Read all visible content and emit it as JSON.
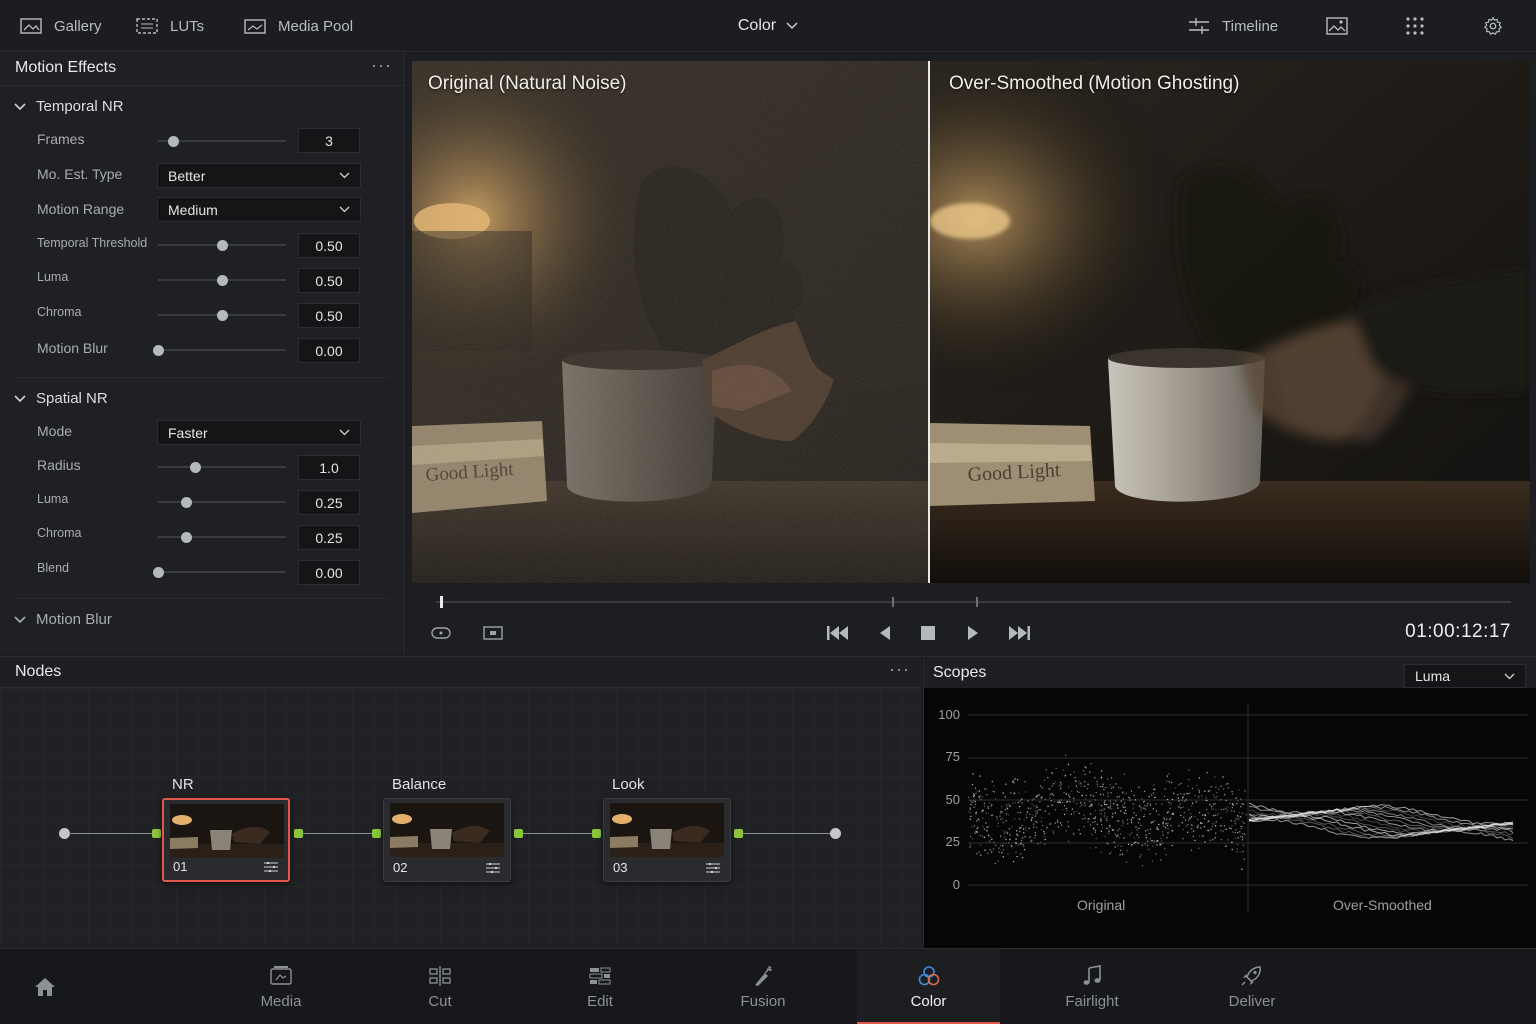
{
  "topbar": {
    "gallery": "Gallery",
    "luts": "LUTs",
    "media_pool": "Media Pool",
    "page": "Color",
    "timeline": "Timeline"
  },
  "motion_panel": {
    "title": "Motion Effects",
    "temporal_nr": {
      "header": "Temporal NR",
      "frames_label": "Frames",
      "frames_value": "3",
      "frames_level": 0.12,
      "mo_est_label": "Mo. Est. Type",
      "mo_est_value": "Better",
      "motion_range_label": "Motion Range",
      "motion_range_value": "Medium",
      "threshold_label": "Temporal Threshold",
      "threshold_value": "0.50",
      "threshold_level": 0.5,
      "luma_label": "Luma",
      "luma_value": "0.50",
      "luma_level": 0.5,
      "chroma_label": "Chroma",
      "chroma_value": "0.50",
      "chroma_level": 0.5,
      "blur_label": "Motion Blur",
      "blur_value": "0.00",
      "blur_level": 0.0
    },
    "spatial_nr": {
      "header": "Spatial NR",
      "mode_label": "Mode",
      "mode_value": "Faster",
      "radius_label": "Radius",
      "radius_value": "1.0",
      "radius_level": 0.29,
      "luma_label": "Luma",
      "luma_value": "0.25",
      "luma_level": 0.22,
      "chroma_label": "Chroma",
      "chroma_value": "0.25",
      "chroma_level": 0.22,
      "blend_label": "Blend",
      "blend_value": "0.00",
      "blend_level": 0.0
    },
    "motion_blur_header": "Motion Blur"
  },
  "viewer": {
    "left_label": "Original (Natural Noise)",
    "right_label": "Over-Smoothed (Motion Ghosting)",
    "book_text": "Good Light",
    "timecode": "01:00:12:17"
  },
  "nodes": {
    "title": "Nodes",
    "items": [
      {
        "label": "NR",
        "number": "01"
      },
      {
        "label": "Balance",
        "number": "02"
      },
      {
        "label": "Look",
        "number": "03"
      }
    ]
  },
  "scopes": {
    "title": "Scopes",
    "mode": "Luma",
    "y_ticks": [
      "100",
      "75",
      "50",
      "25",
      "0"
    ],
    "left_label": "Original",
    "right_label": "Over-Smoothed"
  },
  "nav": {
    "media": "Media",
    "cut": "Cut",
    "edit": "Edit",
    "fusion": "Fusion",
    "color": "Color",
    "fairlight": "Fairlight",
    "deliver": "Deliver"
  },
  "colors": {
    "accent_red": "#e1574a",
    "node_green": "#8ac43a",
    "color_page_icon": "#3d8fe0"
  }
}
